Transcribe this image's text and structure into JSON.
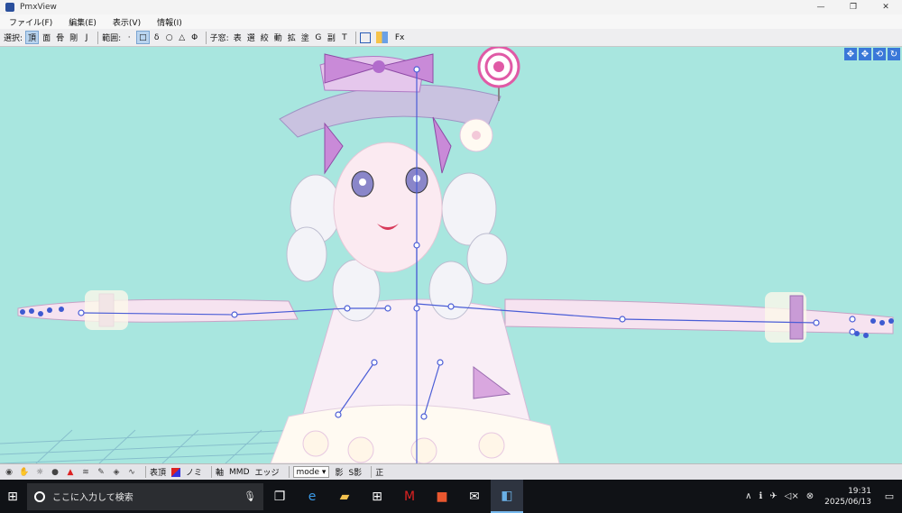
{
  "window": {
    "title": "PmxView",
    "controls": [
      "—",
      "❐",
      "✕"
    ]
  },
  "menu": [
    {
      "label": "ファイル(F)"
    },
    {
      "label": "編集(E)"
    },
    {
      "label": "表示(V)"
    },
    {
      "label": "情報(I)"
    }
  ],
  "toolbar": {
    "select_label": "選択:",
    "select_modes": [
      "頂",
      "面",
      "骨",
      "剛",
      "J"
    ],
    "range_label": "範囲:",
    "range_modes": [
      "·",
      "□",
      "δ",
      "○",
      "△",
      "Φ"
    ],
    "sub_label": "子窓:",
    "sub_windows": [
      "表",
      "選",
      "絞",
      "動",
      "拡",
      "塗",
      "G",
      "副",
      "T"
    ],
    "fx_label": "Fx"
  },
  "view_controls": [
    "✥",
    "✥",
    "⟲",
    "↻"
  ],
  "bottombar": {
    "items": [
      "表頂",
      "ノミ",
      "軸",
      "MMD",
      "エッジ"
    ],
    "mode_value": "mode",
    "shadow_labels": [
      "影",
      "S影"
    ],
    "fix_label": "正"
  },
  "taskbar": {
    "search_placeholder": "ここに入力して検索",
    "clock_time": "19:31",
    "clock_date": "2025/06/13"
  },
  "colors": {
    "viewport_bg": "#a8e6df",
    "accent": "#3a78d8"
  }
}
